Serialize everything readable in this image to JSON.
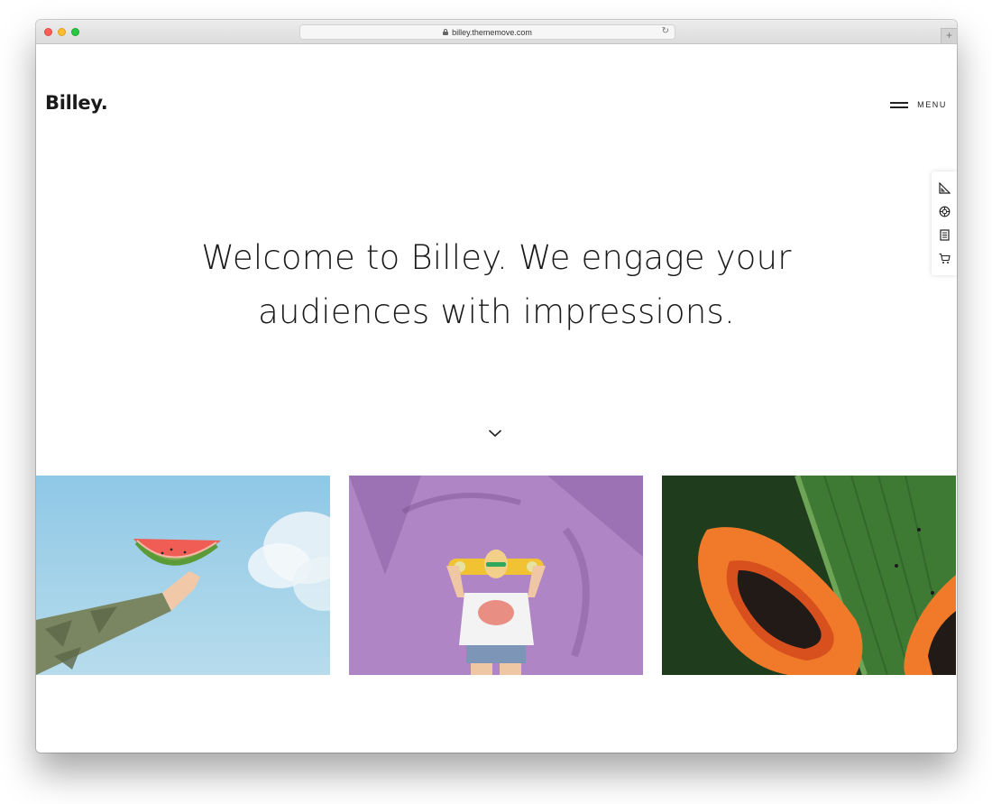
{
  "browser": {
    "url": "billey.thememove.com",
    "new_tab_label": "+"
  },
  "header": {
    "logo": "Billey.",
    "menu_label": "MENU"
  },
  "hero": {
    "line1": "Welcome to Billey. We engage your",
    "line2": "audiences with impressions."
  },
  "side_tools": [
    "ruler-icon",
    "lifebuoy-icon",
    "document-icon",
    "cart-icon"
  ],
  "gallery": [
    {
      "name": "watermelon-photo"
    },
    {
      "name": "skateboard-girl-photo"
    },
    {
      "name": "papaya-photo"
    }
  ],
  "colors": {
    "text": "#1a1a1a",
    "sky": "#9ecfe6",
    "lilac": "#b083c4",
    "leaf": "#2f5d2a",
    "papaya": "#f07a2a"
  }
}
